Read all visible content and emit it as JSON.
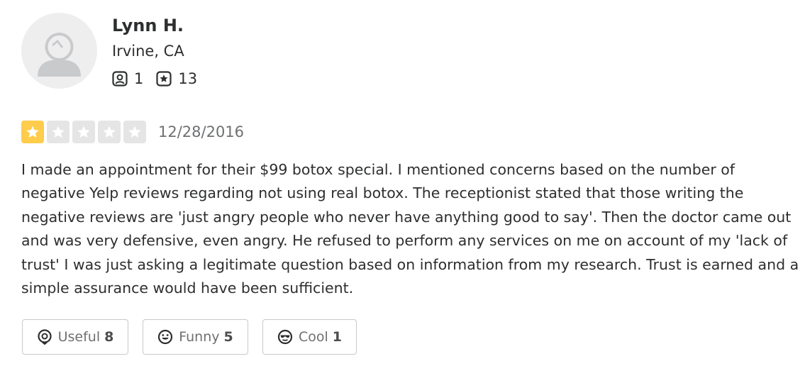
{
  "user": {
    "name": "Lynn H.",
    "location": "Irvine, CA",
    "friends_count": "1",
    "reviews_count": "13",
    "avatar_icon": "default-user-avatar-icon",
    "friends_icon": "friends-icon",
    "reviews_icon": "reviews-star-icon"
  },
  "review": {
    "rating": 1,
    "rating_max": 5,
    "date": "12/28/2016",
    "text": "I made an appointment for their $99 botox special. I mentioned concerns based on the number of negative Yelp reviews regarding not using real botox. The receptionist stated that those writing the negative reviews are 'just angry people who never have anything good to say'. Then the doctor came out and was very defensive, even angry. He refused to perform any services on me on account of my 'lack of  trust'  I was just asking a legitimate question based on information from my research. Trust is earned and a simple assurance would have been sufficient."
  },
  "reactions": {
    "useful": {
      "label": "Useful",
      "count": "8",
      "icon": "lightbulb-icon"
    },
    "funny": {
      "label": "Funny",
      "count": "5",
      "icon": "smile-icon"
    },
    "cool": {
      "label": "Cool",
      "count": "1",
      "icon": "sunglasses-icon"
    }
  },
  "colors": {
    "star_filled": "#ffcc4b",
    "star_empty": "#e5e5e6",
    "text_primary": "#2d2e2f",
    "text_secondary": "#6e7072",
    "border": "#c8c9ca",
    "avatar_bg": "#eeeeef",
    "avatar_fg": "#c9cacc"
  }
}
